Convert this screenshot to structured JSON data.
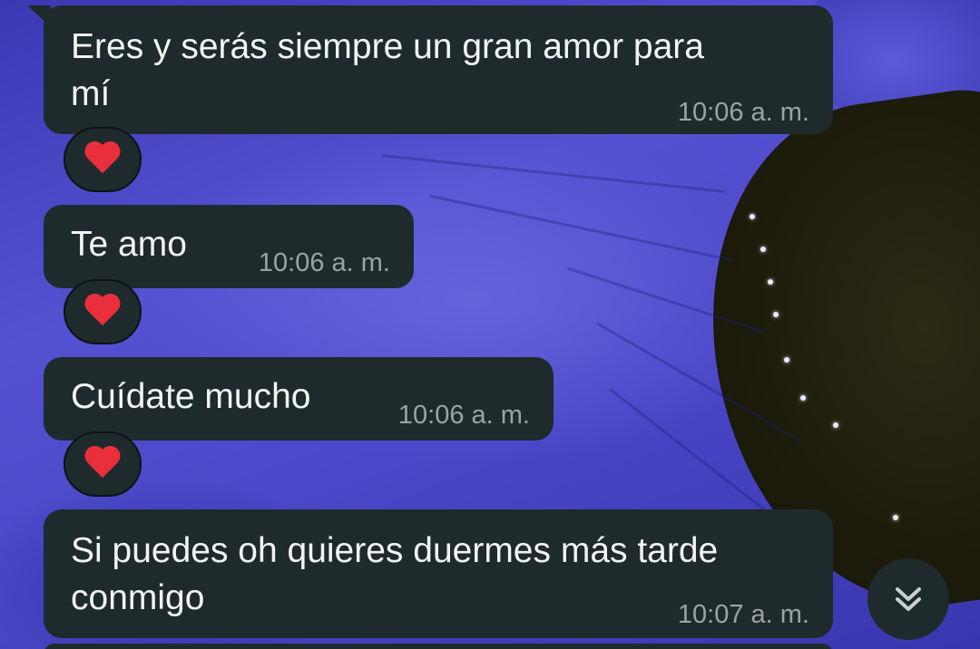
{
  "messages": [
    {
      "text": "Eres y serás siempre un gran amor para\nmí",
      "time": "10:06 a. m.",
      "reaction": "heart"
    },
    {
      "text": "Te amo",
      "time": "10:06 a. m.",
      "reaction": "heart"
    },
    {
      "text": "Cuídate mucho",
      "time": "10:06 a. m.",
      "reaction": "heart"
    },
    {
      "text": "Si puedes oh quieres duermes más tarde\nconmigo",
      "time": "10:07 a. m."
    }
  ],
  "colors": {
    "bubble": "#1f2a2c",
    "timestamp": "#9aa4a6",
    "heart": "#ea2f3c",
    "wallpaper": "#4a46c6"
  },
  "icons": {
    "reaction": "red-heart-icon",
    "scroll": "double-chevron-down-icon"
  }
}
